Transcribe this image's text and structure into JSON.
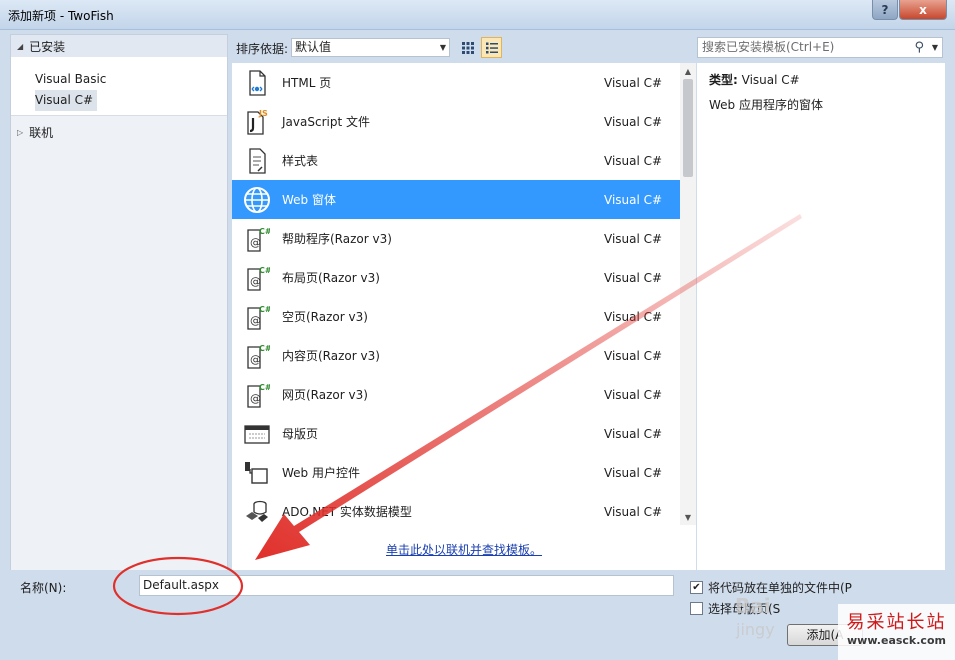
{
  "window": {
    "title": "添加新项 - TwoFish",
    "help": "?",
    "close": "x"
  },
  "tree": {
    "installed": "已安装",
    "items": [
      "Visual Basic",
      "Visual C#"
    ],
    "online": "联机"
  },
  "toolbar": {
    "sort_label": "排序依据:",
    "sort_value": "默认值",
    "search_placeholder": "搜索已安装模板(Ctrl+E)"
  },
  "templates": [
    {
      "name": "HTML 页",
      "lang": "Visual C#",
      "icon": "html-page-icon"
    },
    {
      "name": "JavaScript 文件",
      "lang": "Visual C#",
      "icon": "javascript-file-icon"
    },
    {
      "name": "样式表",
      "lang": "Visual C#",
      "icon": "stylesheet-icon"
    },
    {
      "name": "Web 窗体",
      "lang": "Visual C#",
      "icon": "web-form-icon",
      "selected": true
    },
    {
      "name": "帮助程序(Razor v3)",
      "lang": "Visual C#",
      "icon": "razor-icon"
    },
    {
      "name": "布局页(Razor v3)",
      "lang": "Visual C#",
      "icon": "razor-icon"
    },
    {
      "name": "空页(Razor v3)",
      "lang": "Visual C#",
      "icon": "razor-icon"
    },
    {
      "name": "内容页(Razor v3)",
      "lang": "Visual C#",
      "icon": "razor-icon"
    },
    {
      "name": "网页(Razor v3)",
      "lang": "Visual C#",
      "icon": "razor-icon"
    },
    {
      "name": "母版页",
      "lang": "Visual C#",
      "icon": "master-page-icon"
    },
    {
      "name": "Web 用户控件",
      "lang": "Visual C#",
      "icon": "user-control-icon"
    },
    {
      "name": "ADO.NET 实体数据模型",
      "lang": "Visual C#",
      "icon": "entity-model-icon"
    }
  ],
  "online_link": "单击此处以联机并查找模板。",
  "info": {
    "type_label": "类型:",
    "type_value": "Visual C#",
    "description": "Web 应用程序的窗体"
  },
  "bottom": {
    "name_label": "名称(N):",
    "name_value": "Default.aspx",
    "checkbox1": "将代码放在单独的文件中(P",
    "checkbox1_checked": true,
    "checkbox2": "选择母版页(S",
    "checkbox2_checked": false,
    "add_button": "添加(A"
  },
  "watermark": {
    "site_cn": "易采站长站",
    "site_url": "www.easck.com",
    "baidu": "Bai",
    "jingyan": "jingy"
  },
  "colors": {
    "selection": "#3399ff",
    "annotation": "#e0302b",
    "link": "#1a3fb0"
  }
}
